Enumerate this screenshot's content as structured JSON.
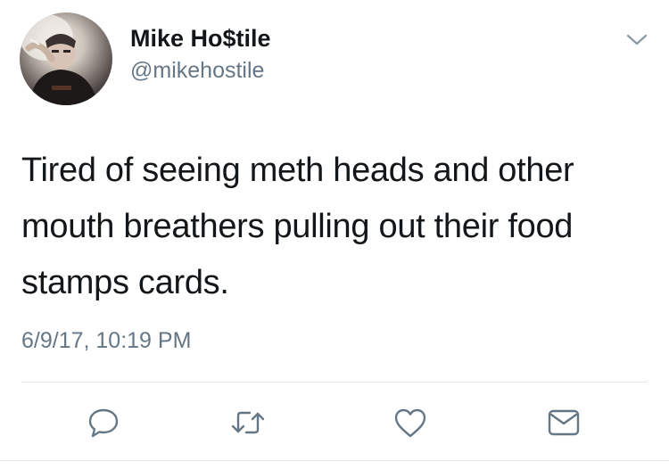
{
  "author": {
    "display_name": "Mike Ho$tile",
    "handle": "@mikehostile",
    "avatar_icon": "profile-photo"
  },
  "tweet": {
    "text": "Tired of seeing meth heads and other mouth breathers pulling out their food stamps cards.",
    "timestamp": "6/9/17, 10:19 PM"
  },
  "actions": {
    "reply_icon": "reply-icon",
    "retweet_icon": "retweet-icon",
    "like_icon": "heart-icon",
    "message_icon": "envelope-icon"
  },
  "colors": {
    "text_primary": "#14171a",
    "text_secondary": "#657786",
    "divider": "#e1e8ed",
    "icon": "#657786"
  }
}
